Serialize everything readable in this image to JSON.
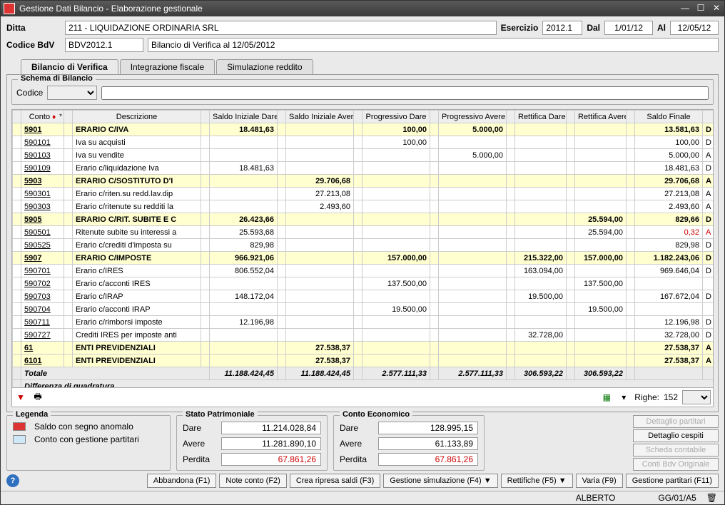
{
  "window_title": "Gestione Dati Bilancio - Elaborazione gestionale",
  "header": {
    "ditta_label": "Ditta",
    "ditta_value": "211 - LIQUIDAZIONE ORDINARIA SRL",
    "esercizio_label": "Esercizio",
    "esercizio_value": "2012.1",
    "dal_label": "Dal",
    "dal_value": "1/01/12",
    "al_label": "Al",
    "al_value": "12/05/12",
    "codice_bdv_label": "Codice BdV",
    "codice_bdv_value": "BDV2012.1",
    "bdv_desc": "Bilancio di Verifica al 12/05/2012"
  },
  "tabs": {
    "t1": "Bilancio di Verifica",
    "t2": "Integrazione fiscale",
    "t3": "Simulazione reddito"
  },
  "schema": {
    "title": "Schema di Bilancio",
    "codice_label": "Codice"
  },
  "columns": {
    "conto": "Conto",
    "descr": "Descrizione",
    "sid": "Saldo Iniziale Dare",
    "sia": "Saldo Iniziale Avere",
    "pd": "Progressivo Dare",
    "pa": "Progressivo Avere",
    "rd": "Rettifica Dare",
    "ra": "Rettifica Avere",
    "sf": "Saldo Finale"
  },
  "rows": [
    {
      "g": true,
      "conto": "5901",
      "desc": "ERARIO C/IVA",
      "sid": "18.481,63",
      "sia": "",
      "pd": "100,00",
      "pa": "5.000,00",
      "rd": "",
      "ra": "",
      "sf": "13.581,63",
      "f": "D"
    },
    {
      "conto": "590101",
      "desc": "Iva su acquisti",
      "sid": "",
      "sia": "",
      "pd": "100,00",
      "pa": "",
      "rd": "",
      "ra": "",
      "sf": "100,00",
      "f": "D"
    },
    {
      "conto": "590103",
      "desc": "Iva su vendite",
      "sid": "",
      "sia": "",
      "pd": "",
      "pa": "5.000,00",
      "rd": "",
      "ra": "",
      "sf": "5.000,00",
      "f": "A"
    },
    {
      "conto": "590109",
      "desc": "Erario c/liquidazione Iva",
      "sid": "18.481,63",
      "sia": "",
      "pd": "",
      "pa": "",
      "rd": "",
      "ra": "",
      "sf": "18.481,63",
      "f": "D"
    },
    {
      "g": true,
      "conto": "5903",
      "desc": "ERARIO C/SOSTITUTO D'I",
      "sid": "",
      "sia": "29.706,68",
      "pd": "",
      "pa": "",
      "rd": "",
      "ra": "",
      "sf": "29.706,68",
      "f": "A"
    },
    {
      "conto": "590301",
      "desc": "Erario c/riten.su redd.lav.dip",
      "sid": "",
      "sia": "27.213,08",
      "pd": "",
      "pa": "",
      "rd": "",
      "ra": "",
      "sf": "27.213,08",
      "f": "A"
    },
    {
      "conto": "590303",
      "desc": "Erario c/ritenute su redditi la",
      "sid": "",
      "sia": "2.493,60",
      "pd": "",
      "pa": "",
      "rd": "",
      "ra": "",
      "sf": "2.493,60",
      "f": "A"
    },
    {
      "g": true,
      "conto": "5905",
      "desc": "ERARIO C/RIT. SUBITE E C",
      "sid": "26.423,66",
      "sia": "",
      "pd": "",
      "pa": "",
      "rd": "",
      "ra": "25.594,00",
      "sf": "829,66",
      "f": "D"
    },
    {
      "conto": "590501",
      "desc": "Ritenute subite su interessi a",
      "sid": "25.593,68",
      "sia": "",
      "pd": "",
      "pa": "",
      "rd": "",
      "ra": "25.594,00",
      "sf": "0,32",
      "f": "A",
      "red": true
    },
    {
      "conto": "590525",
      "desc": "Erario c/crediti d'imposta su",
      "sid": "829,98",
      "sia": "",
      "pd": "",
      "pa": "",
      "rd": "",
      "ra": "",
      "sf": "829,98",
      "f": "D"
    },
    {
      "g": true,
      "conto": "5907",
      "desc": "ERARIO C/IMPOSTE",
      "sid": "966.921,06",
      "sia": "",
      "pd": "157.000,00",
      "pa": "",
      "rd": "215.322,00",
      "ra": "157.000,00",
      "sf": "1.182.243,06",
      "f": "D"
    },
    {
      "conto": "590701",
      "desc": "Erario c/IRES",
      "sid": "806.552,04",
      "sia": "",
      "pd": "",
      "pa": "",
      "rd": "163.094,00",
      "ra": "",
      "sf": "969.646,04",
      "f": "D"
    },
    {
      "conto": "590702",
      "desc": "Erario c/acconti IRES",
      "sid": "",
      "sia": "",
      "pd": "137.500,00",
      "pa": "",
      "rd": "",
      "ra": "137.500,00",
      "sf": "",
      "f": ""
    },
    {
      "conto": "590703",
      "desc": "Erario c/IRAP",
      "sid": "148.172,04",
      "sia": "",
      "pd": "",
      "pa": "",
      "rd": "19.500,00",
      "ra": "",
      "sf": "167.672,04",
      "f": "D"
    },
    {
      "conto": "590704",
      "desc": "Erario c/acconti IRAP",
      "sid": "",
      "sia": "",
      "pd": "19.500,00",
      "pa": "",
      "rd": "",
      "ra": "19.500,00",
      "sf": "",
      "f": ""
    },
    {
      "conto": "590711",
      "desc": "Erario c/rimborsi imposte",
      "sid": "12.196,98",
      "sia": "",
      "pd": "",
      "pa": "",
      "rd": "",
      "ra": "",
      "sf": "12.196,98",
      "f": "D"
    },
    {
      "conto": "590727",
      "desc": "Crediti IRES per imposte anti",
      "sid": "",
      "sia": "",
      "pd": "",
      "pa": "",
      "rd": "32.728,00",
      "ra": "",
      "sf": "32.728,00",
      "f": "D"
    },
    {
      "g": true,
      "conto": "61",
      "desc": "ENTI PREVIDENZIALI",
      "sid": "",
      "sia": "27.538,37",
      "pd": "",
      "pa": "",
      "rd": "",
      "ra": "",
      "sf": "27.538,37",
      "f": "A"
    },
    {
      "g": true,
      "conto": "6101",
      "desc": "ENTI PREVIDENZIALI",
      "sid": "",
      "sia": "27.538,37",
      "pd": "",
      "pa": "",
      "rd": "",
      "ra": "",
      "sf": "27.538,37",
      "f": "A"
    }
  ],
  "totals": {
    "label": "Totale",
    "sid": "11.188.424,45",
    "sia": "11.188.424,45",
    "pd": "2.577.111,33",
    "pa": "2.577.111,33",
    "rd": "306.593,22",
    "ra": "306.593,22",
    "sf": ""
  },
  "quadr_label": "Differenza di quadratura",
  "rowcount": {
    "label": "Righe:",
    "value": "152"
  },
  "legenda": {
    "title": "Legenda",
    "anom": "Saldo con segno anomalo",
    "partitari": "Conto con gestione partitari"
  },
  "stato": {
    "title": "Stato Patrimoniale",
    "dare": "Dare",
    "dare_v": "11.214.028,84",
    "avere": "Avere",
    "avere_v": "11.281.890,10",
    "perdita": "Perdita",
    "perdita_v": "67.861,26"
  },
  "conto_ec": {
    "title": "Conto Economico",
    "dare": "Dare",
    "dare_v": "128.995,15",
    "avere": "Avere",
    "avere_v": "61.133,89",
    "perdita": "Perdita",
    "perdita_v": "67.861,26"
  },
  "sidebtns": {
    "partitari": "Dettaglio partitari",
    "cespiti": "Dettaglio cespiti",
    "scheda": "Scheda contabile",
    "bdvorig": "Conti Bdv Originale"
  },
  "actions": {
    "abbandona": "Abbandona (F1)",
    "note": "Note conto (F2)",
    "ripresa": "Crea ripresa saldi (F3)",
    "simul": "Gestione simulazione (F4) ▼",
    "rett": "Rettifiche (F5) ▼",
    "varia": "Varia (F9)",
    "part": "Gestione partitari (F11)"
  },
  "status": {
    "user": "ALBERTO",
    "code": "GG/01/A5"
  }
}
